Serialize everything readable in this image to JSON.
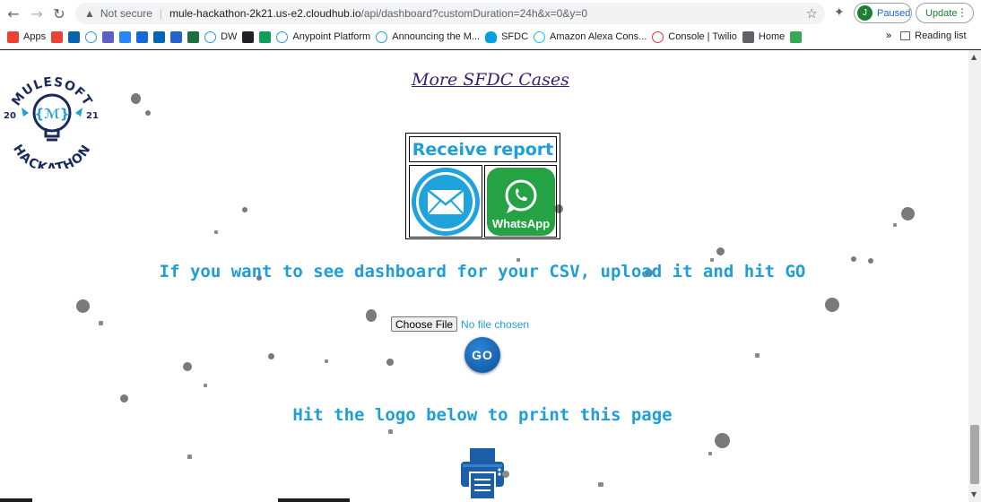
{
  "browser": {
    "security_label": "Not secure",
    "url_host": "mule-hackathon-2k21.us-e2.cloudhub.io",
    "url_path": "/api/dashboard?customDuration=24h&x=0&y=0",
    "profile_initial": "J",
    "profile_status": "Paused",
    "update_label": "Update",
    "bookmarks": [
      {
        "label": "Apps",
        "icon": "apps-grid-icon",
        "color": "#ea4335"
      },
      {
        "label": "",
        "icon": "gmail-icon",
        "color": "#ea4335"
      },
      {
        "label": "",
        "icon": "outlook-icon",
        "color": "#0a64ad"
      },
      {
        "label": "",
        "icon": "mulesoft-icon",
        "color": "#1f9fd8"
      },
      {
        "label": "",
        "icon": "teams-icon",
        "color": "#5b5fc7"
      },
      {
        "label": "",
        "icon": "jira-icon",
        "color": "#2684ff"
      },
      {
        "label": "",
        "icon": "confluence-icon",
        "color": "#1868db"
      },
      {
        "label": "",
        "icon": "onedrive-icon",
        "color": "#0364b8"
      },
      {
        "label": "",
        "icon": "planner-icon",
        "color": "#2564cf"
      },
      {
        "label": "",
        "icon": "excel-icon",
        "color": "#1d6f42"
      },
      {
        "label": "DW",
        "icon": "mulesoft-icon",
        "color": "#1f9fd8"
      },
      {
        "label": "",
        "icon": "cb-icon",
        "color": "#202124"
      },
      {
        "label": "",
        "icon": "tc-icon",
        "color": "#0f9d58"
      },
      {
        "label": "Anypoint Platform",
        "icon": "mulesoft-icon",
        "color": "#1f9fd8"
      },
      {
        "label": "Announcing the M...",
        "icon": "mulesoft-icon",
        "color": "#1f9fd8"
      },
      {
        "label": "SFDC",
        "icon": "salesforce-cloud-icon",
        "color": "#00a1e0"
      },
      {
        "label": "Amazon Alexa Cons...",
        "icon": "alexa-icon",
        "color": "#00caff"
      },
      {
        "label": "Console | Twilio",
        "icon": "twilio-icon",
        "color": "#f22f46"
      },
      {
        "label": "Home",
        "icon": "home-eye-icon",
        "color": "#5f6368"
      },
      {
        "label": "",
        "icon": "green-square-icon",
        "color": "#34a853"
      }
    ],
    "overflow_label": "»",
    "reading_list_label": "Reading list"
  },
  "page": {
    "more_cases_link": "More SFDC Cases",
    "receive_report_label": "Receive report",
    "whatsapp_label": "WhatsApp",
    "csv_heading": "If you want to see dashboard for your CSV, upload it and hit GO",
    "choose_file_label": "Choose File",
    "no_file_label": "No file chosen",
    "go_label": "GO",
    "print_heading": "Hit the logo below to print this page",
    "logo": {
      "top_text": "MULESOFT",
      "bottom_text": "HACKATHON",
      "year_left": "20",
      "year_right": "21"
    }
  },
  "colors": {
    "accent_blue": "#1f9fd8",
    "whatsapp_green": "#25a244",
    "link_purple": "#3a1d6e",
    "logo_navy": "#1a2a5a"
  }
}
